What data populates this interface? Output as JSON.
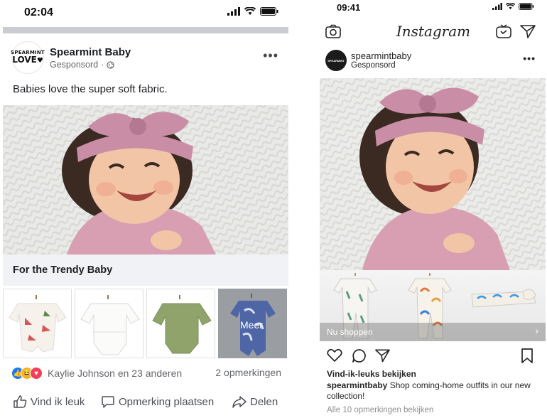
{
  "facebook": {
    "status_time": "02:04",
    "advertiser": {
      "name": "Spearmint Baby",
      "sponsored_label": "Gesponsord",
      "logo_line1": "SPEARMINT",
      "logo_line2": "LOVE"
    },
    "caption": "Babies love the super soft fabric.",
    "cta_title": "For the Trendy Baby",
    "carousel": {
      "items": [
        "watermelon-onesie",
        "white-onesie",
        "green-onesie",
        "floral-onesie"
      ],
      "more_label": "Meer"
    },
    "reactions": {
      "names": "Kaylie Johnson en 23 anderen",
      "comments": "2 opmerkingen",
      "icons": [
        "like-icon",
        "haha-icon",
        "love-icon"
      ]
    },
    "actions": {
      "like": "Vind ik leuk",
      "comment": "Opmerking plaatsen",
      "share": "Delen"
    },
    "colors": {
      "like_blue": "#1877f2",
      "love_red": "#f33e58",
      "haha_yellow": "#f7b125"
    }
  },
  "instagram": {
    "status_time": "09:41",
    "brand": "Instagram",
    "account": {
      "username": "spearmintbaby",
      "sponsored_label": "Gesponsord"
    },
    "shop_label": "Nu shoppen",
    "shop_items": [
      "cactus-romper",
      "rainbow-romper",
      "rainbow-headband"
    ],
    "likes_label": "Vind-ik-leuks bekijken",
    "caption_user": "spearmintbaby",
    "caption_text": "Shop coming-home outfits in our new collection!",
    "view_comments": "Alle 10 opmerkingen bekijken"
  }
}
